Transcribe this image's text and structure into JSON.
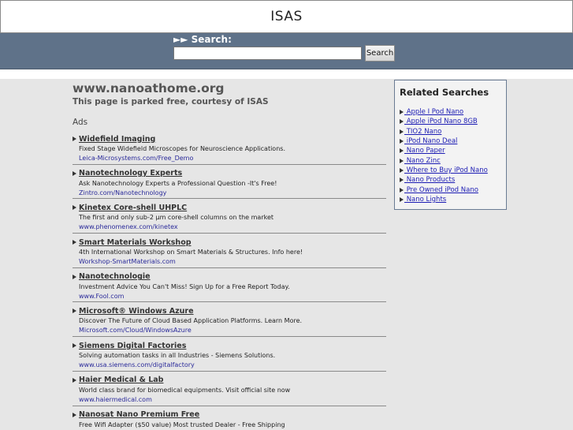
{
  "header": {
    "title": "ISAS"
  },
  "search": {
    "label": "►► Search:",
    "value": "",
    "button_label": "Search"
  },
  "main": {
    "domain": "www.nanoathome.org",
    "subtitle": "This page is parked free, courtesy of ISAS",
    "ads_label": "Ads",
    "ads": [
      {
        "title": "Widefield Imaging",
        "desc": "Fixed Stage Widefield Microscopes for Neuroscience Applications.",
        "url": "Leica-Microsystems.com/Free_Demo"
      },
      {
        "title": "Nanotechnology Experts",
        "desc": "Ask Nanotechnology Experts a Professional Question -It's Free!",
        "url": "Zintro.com/Nanotechnology"
      },
      {
        "title": "Kinetex Core-shell UHPLC",
        "desc": "The first and only sub-2 µm core-shell columns on the market",
        "url": "www.phenomenex.com/kinetex"
      },
      {
        "title": "Smart Materials Workshop",
        "desc": "4th International Workshop on Smart Materials & Structures. Info here!",
        "url": "Workshop-SmartMaterials.com"
      },
      {
        "title": "Nanotechnologie",
        "desc": "Investment Advice You Can't Miss! Sign Up for a Free Report Today.",
        "url": "www.Fool.com"
      },
      {
        "title": "Microsoft® Windows Azure",
        "desc": "Discover The Future of Cloud Based Application Platforms. Learn More.",
        "url": "Microsoft.com/Cloud/WindowsAzure"
      },
      {
        "title": "Siemens Digital Factories",
        "desc": "Solving automation tasks in all Industries - Siemens Solutions.",
        "url": "www.usa.siemens.com/digitalfactory"
      },
      {
        "title": "Haier Medical & Lab",
        "desc": "World class brand for biomedical equipments. Visit official site now",
        "url": "www.haiermedical.com"
      },
      {
        "title": "Nanosat Nano Premium Free",
        "desc": "Free Wifi Adapter ($50 value) Most trusted Dealer - Free Shipping",
        "url": ""
      }
    ]
  },
  "related": {
    "title": "Related Searches",
    "items": [
      " Apple I Pod Nano",
      " Apple iPod Nano 8GB",
      " TIO2 Nano",
      " iPod Nano Deal",
      " Nano Paper",
      " Nano Zinc",
      " Where to Buy iPod Nano",
      " Nano Products",
      " Pre Owned iPod Nano",
      " Nano Lights"
    ]
  }
}
